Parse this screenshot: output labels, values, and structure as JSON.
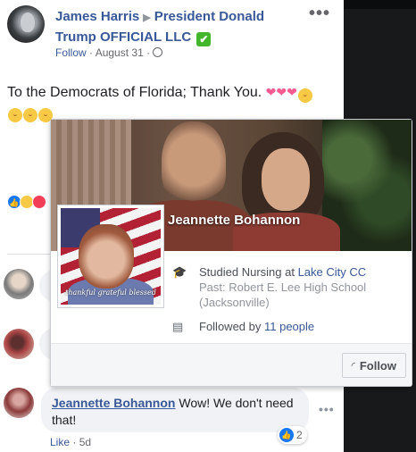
{
  "post": {
    "author": "James Harris",
    "target_page": "President Donald Trump OFFICIAL LLC",
    "verified_mark": "✔",
    "follow_label": "Follow",
    "date": "August 31",
    "separator": "·",
    "privacy_icon": "globe-icon",
    "more_label": "•••",
    "text": "To the Democrats of Florida; Thank You.",
    "text_emojis_line1": [
      "heart",
      "heart",
      "heart",
      "laugh"
    ],
    "text_emojis_line2": [
      "laugh",
      "laugh",
      "laugh"
    ],
    "reactions": [
      "like",
      "wow",
      "love"
    ]
  },
  "hover_card": {
    "name": "Jeannette Bohannon",
    "profile_caption": "thankful grateful blessed",
    "education_prefix": "Studied Nursing at ",
    "education_school": "Lake City CC",
    "past_prefix": "Past: ",
    "past_school": "Robert E. Lee High School (Jacksonville)",
    "followed_prefix": "Followed by ",
    "followed_count": "11 people",
    "follow_button": "Follow",
    "follow_icon": "rss-icon",
    "education_icon": "graduation-cap-icon",
    "followers_icon": "id-card-icon"
  },
  "comment": {
    "author": "Jeannette Bohannon",
    "text": "Wow! We don't need that!",
    "like_label": "Like",
    "separator": "·",
    "age": "5d",
    "reaction_count": "2",
    "more_label": "•••"
  },
  "colors": {
    "link": "#385898",
    "verified": "#42b72a",
    "like_blue": "#1877f2",
    "background_dark": "#18191a"
  }
}
